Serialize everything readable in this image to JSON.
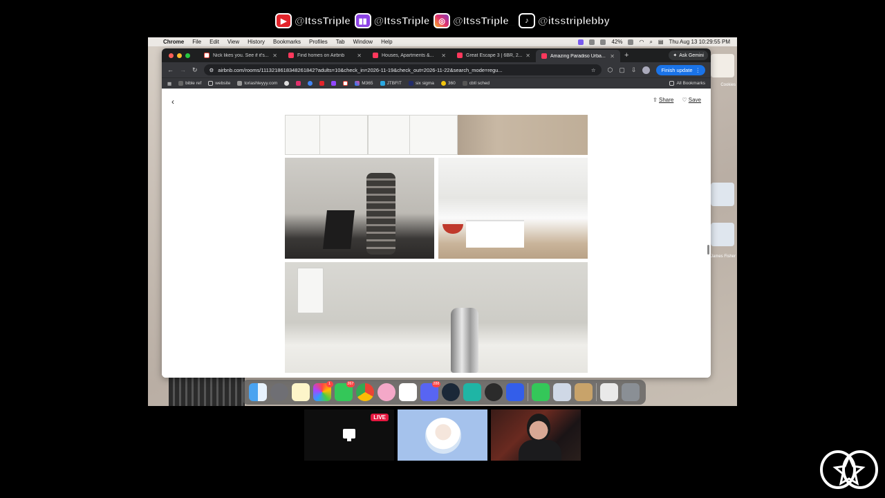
{
  "socials": [
    {
      "platform": "youtube-icon",
      "handle": "@ItssTriple"
    },
    {
      "platform": "twitch-icon",
      "handle": "@ItssTriple"
    },
    {
      "platform": "instagram-icon",
      "handle": "@ItssTriple_"
    },
    {
      "platform": "tiktok-icon",
      "handle": "@itsstriplebby"
    }
  ],
  "menubar": {
    "app": "Chrome",
    "items": [
      "File",
      "Edit",
      "View",
      "History",
      "Bookmarks",
      "Profiles",
      "Tab",
      "Window",
      "Help"
    ],
    "battery": "42%",
    "datetime": "Thu Aug 13  10:29:55 PM"
  },
  "tabs": [
    {
      "label": "Nick likes you. See if it's...",
      "icon": "gmail-icon",
      "active": false
    },
    {
      "label": "Find homes on Airbnb",
      "icon": "airbnb-icon",
      "active": false
    },
    {
      "label": "Houses, Apartments &...",
      "icon": "airbnb-icon",
      "active": false
    },
    {
      "label": "Great Escape 3 | 6BR, 2...",
      "icon": "airbnb-icon",
      "active": false
    },
    {
      "label": "Amazing Paradiso Urba...",
      "icon": "airbnb-icon",
      "active": true
    }
  ],
  "gemini_label": "Ask Gemini",
  "omnibox": {
    "url": "airbnb.com/rooms/1113218618348261842?adults=10&check_in=2026-11-19&check_out=2026-11-22&search_mode=regu..."
  },
  "finish_update": "Finish update",
  "bookmarks": [
    {
      "label": "bible ref",
      "icon": "bookmark-icon"
    },
    {
      "label": "website",
      "icon": "folder-icon"
    },
    {
      "label": "toriashleyyy.com",
      "icon": "site-icon"
    },
    {
      "label": "",
      "icon": "site-icon"
    },
    {
      "label": "",
      "icon": "instagram-icon"
    },
    {
      "label": "",
      "icon": "site-icon"
    },
    {
      "label": "",
      "icon": "youtube-icon"
    },
    {
      "label": "",
      "icon": "twitch-icon"
    },
    {
      "label": "",
      "icon": "gmail-icon"
    },
    {
      "label": "M365",
      "icon": "m365-icon"
    },
    {
      "label": "JTBFIT",
      "icon": "site-icon"
    },
    {
      "label": "six sigma",
      "icon": "site-icon"
    },
    {
      "label": "360",
      "icon": "site-icon"
    },
    {
      "label": "cbtl sched",
      "icon": "site-icon"
    }
  ],
  "all_bookmarks": "All Bookmarks",
  "page": {
    "share": "Share",
    "save": "Save"
  },
  "desktop_labels": [
    "Cookies",
    "James Fisher"
  ],
  "dock_badges": {
    "photos": "1",
    "messages": "267",
    "discord": "288"
  },
  "live_badge": "LIVE"
}
